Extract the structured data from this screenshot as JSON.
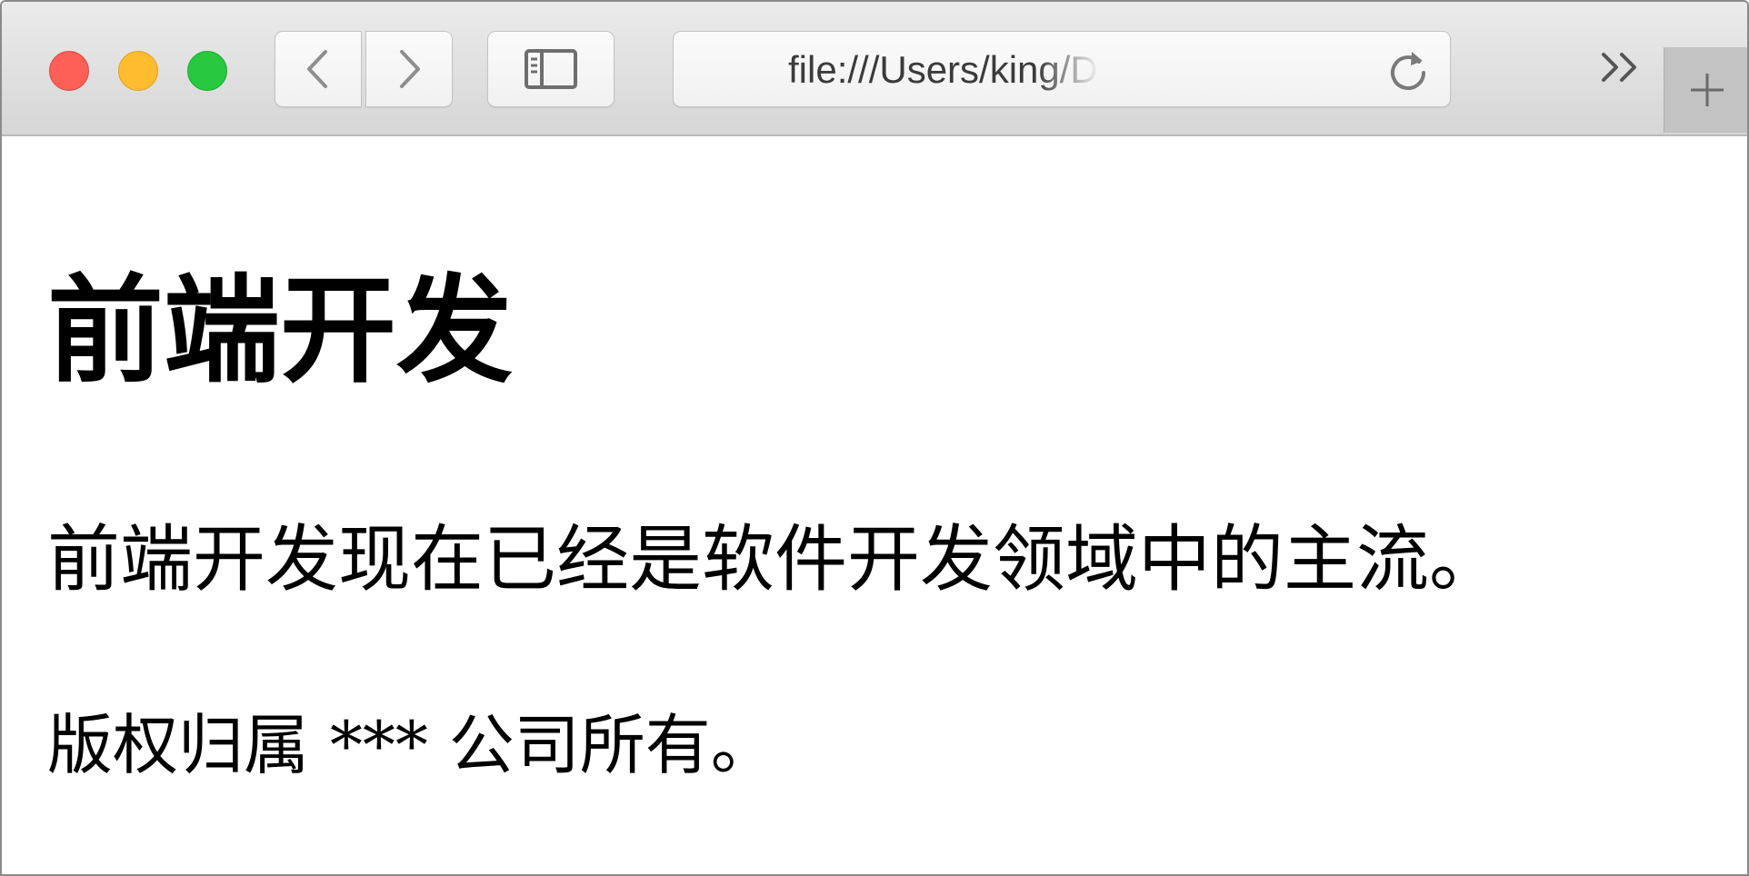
{
  "window": {
    "controls": {
      "close": "close-button",
      "minimize": "minimize-button",
      "maximize": "maximize-button"
    }
  },
  "toolbar": {
    "back_icon": "chevron-left-icon",
    "forward_icon": "chevron-right-icon",
    "sidebar_icon": "sidebar-icon",
    "reload_icon": "reload-icon",
    "overflow_icon": "double-chevron-right-icon",
    "new_tab_icon": "plus-icon"
  },
  "address_bar": {
    "url": "file:///Users/king/Downloads"
  },
  "page": {
    "heading": "前端开发",
    "paragraph": "前端开发现在已经是软件开发领域中的主流。",
    "footer": "版权归属 *** 公司所有。"
  },
  "colors": {
    "close": "#fe5f57",
    "minimize": "#febc2e",
    "maximize": "#28c840",
    "toolbar_top": "#ebebeb",
    "toolbar_bottom": "#d6d6d6",
    "text": "#000000"
  }
}
